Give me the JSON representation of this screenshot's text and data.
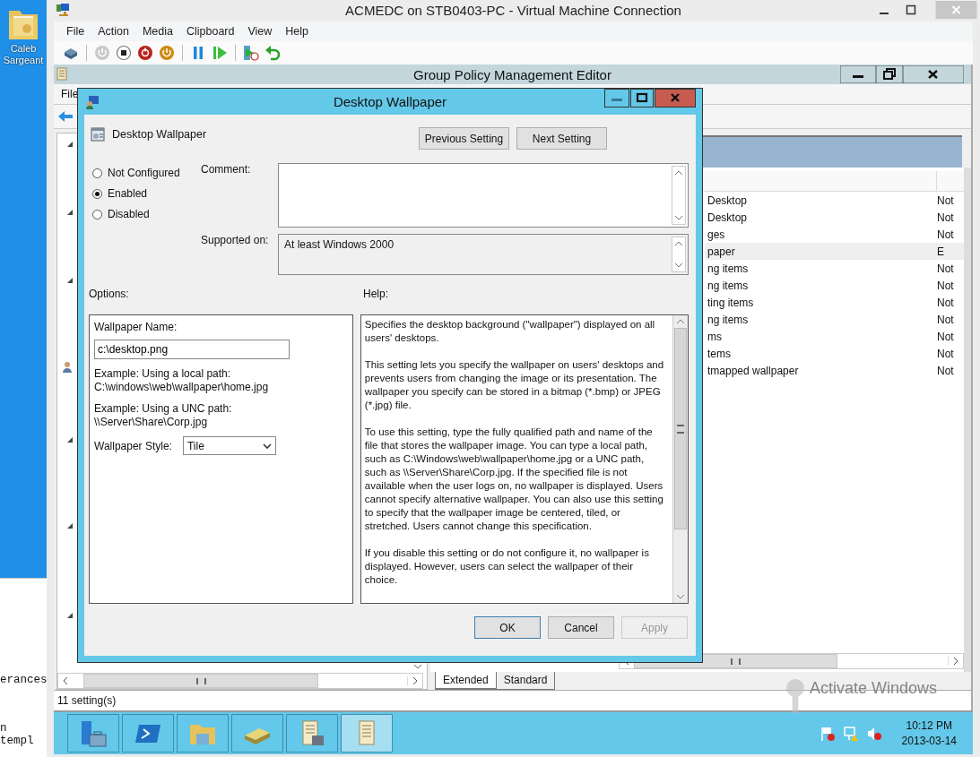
{
  "desktop": {
    "icon_label": "Caleb Sargeant",
    "background_texts": [
      "erances",
      "n templ"
    ]
  },
  "vm_window": {
    "title": "ACMEDC on STB0403-PC - Virtual Machine Connection",
    "menu": [
      "File",
      "Action",
      "Media",
      "Clipboard",
      "View",
      "Help"
    ]
  },
  "gpme": {
    "title": "Group Policy Management Editor",
    "menu": [
      "File"
    ],
    "list_rows": [
      {
        "name": "Desktop",
        "state": "Not",
        "selected": false
      },
      {
        "name": "Desktop",
        "state": "Not",
        "selected": false
      },
      {
        "name": "ges",
        "state": "Not",
        "selected": false
      },
      {
        "name": "paper",
        "state": "E",
        "selected": true
      },
      {
        "name": "ng items",
        "state": "Not",
        "selected": false
      },
      {
        "name": "ng items",
        "state": "Not",
        "selected": false
      },
      {
        "name": "ting items",
        "state": "Not",
        "selected": false
      },
      {
        "name": "ng items",
        "state": "Not",
        "selected": false
      },
      {
        "name": "ms",
        "state": "Not",
        "selected": false
      },
      {
        "name": "tems",
        "state": "Not",
        "selected": false
      },
      {
        "name": "tmapped wallpaper",
        "state": "Not",
        "selected": false
      }
    ],
    "tabs": [
      {
        "label": "Extended",
        "selected": true
      },
      {
        "label": "Standard",
        "selected": false
      }
    ],
    "status": "11 setting(s)"
  },
  "dialog": {
    "title": "Desktop Wallpaper",
    "setting_name": "Desktop Wallpaper",
    "nav_buttons": [
      "Previous Setting",
      "Next Setting"
    ],
    "states": [
      {
        "label": "Not Configured",
        "selected": false
      },
      {
        "label": "Enabled",
        "selected": true
      },
      {
        "label": "Disabled",
        "selected": false
      }
    ],
    "comment_label": "Comment:",
    "supported_label": "Supported on:",
    "supported_value": "At least Windows 2000",
    "options_label": "Options:",
    "help_label": "Help:",
    "options": {
      "name_label": "Wallpaper Name:",
      "name_value": "c:\\desktop.png",
      "examples": [
        [
          "Example: Using a local path:",
          "C:\\windows\\web\\wallpaper\\home.jpg"
        ],
        [
          "Example: Using a UNC path:",
          "\\\\Server\\Share\\Corp.jpg"
        ]
      ],
      "style_label": "Wallpaper Style:",
      "style_value": "Tile"
    },
    "help_paragraphs": [
      "Specifies the desktop background (\"wallpaper\") displayed on all users' desktops.",
      "This setting lets you specify the wallpaper on users' desktops and prevents users from changing the image or its presentation. The wallpaper you specify can be stored in a bitmap (*.bmp) or JPEG (*.jpg) file.",
      "To use this setting, type the fully qualified path and name of the file that stores the wallpaper image. You can type a local path, such as C:\\Windows\\web\\wallpaper\\home.jpg or a UNC path, such as \\\\Server\\Share\\Corp.jpg. If the specified file is not available when the user logs on, no wallpaper is displayed. Users cannot specify alternative wallpaper. You can also use this setting to specify that the wallpaper image be centered, tiled, or stretched. Users cannot change this specification.",
      "If you disable this setting or do not configure it, no wallpaper is displayed. However, users can select the wallpaper of their choice."
    ],
    "buttons": [
      {
        "label": "OK",
        "disabled": false
      },
      {
        "label": "Cancel",
        "disabled": false
      },
      {
        "label": "Apply",
        "disabled": true
      }
    ]
  },
  "taskbar": {
    "buttons": [
      {
        "selected": false
      },
      {
        "selected": false
      },
      {
        "selected": false
      },
      {
        "selected": false
      },
      {
        "selected": false
      },
      {
        "selected": true
      }
    ],
    "time": "10:12 PM",
    "date": "2013-03-14"
  },
  "activation": {
    "title": "Activate Windows"
  }
}
